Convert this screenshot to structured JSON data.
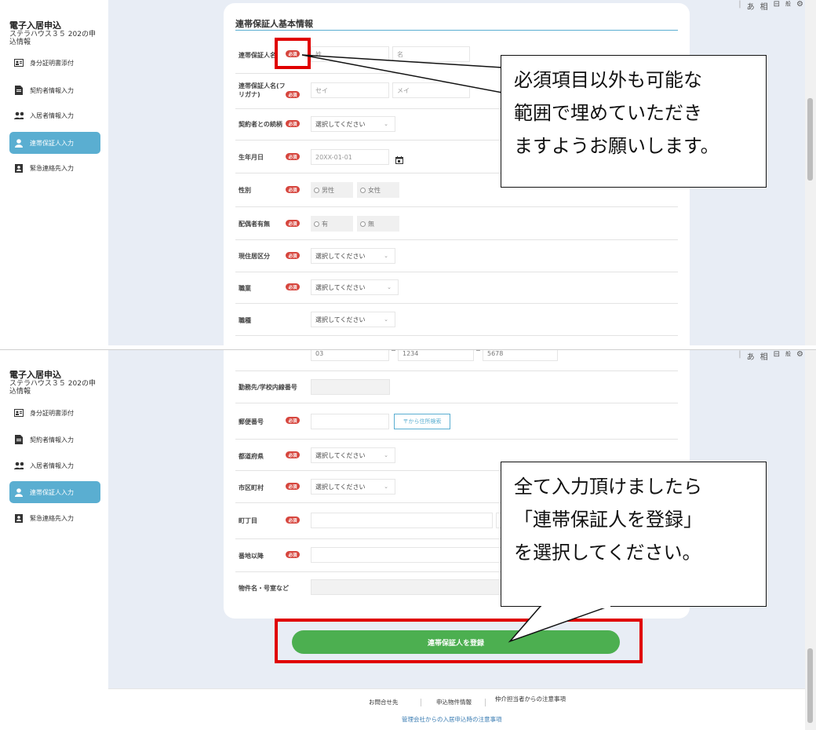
{
  "app": {
    "title": "電子入居申込",
    "subtitle": "ステラハウス３５ 202の申込情報"
  },
  "nav": [
    {
      "label": "身分証明書添付"
    },
    {
      "label": "契約者情報入力"
    },
    {
      "label": "入居者情報入力"
    },
    {
      "label": "連帯保証人入力"
    },
    {
      "label": "緊急連絡先入力"
    }
  ],
  "ime_bar": {
    "kana": "あ",
    "kanji": "相",
    "pad": "⊟",
    "mode": "般",
    "gear": "⚙"
  },
  "form_top": {
    "section_title": "連帯保証人基本情報",
    "required_badge": "必須",
    "rows": {
      "name": {
        "label": "連帯保証人名",
        "last_ph": "姓",
        "first_ph": "名"
      },
      "kana": {
        "label": "連帯保証人名(フリガナ)",
        "last_ph": "セイ",
        "first_ph": "メイ"
      },
      "relation": {
        "label": "契約者との続柄",
        "value": "選択してください"
      },
      "birth": {
        "label": "生年月日",
        "value": "20XX-01-01"
      },
      "gender": {
        "label": "性別",
        "opt1": "男性",
        "opt2": "女性"
      },
      "spouse": {
        "label": "配偶者有無",
        "opt1": "有",
        "opt2": "無"
      },
      "residence": {
        "label": "現住居区分",
        "value": "選択してください"
      },
      "job": {
        "label": "職業",
        "value": "選択してください"
      },
      "job_type": {
        "label": "職種",
        "value": "選択してください"
      }
    }
  },
  "form_bottom": {
    "phone": {
      "p1": "03",
      "p2": "1234",
      "p3": "5678",
      "sep": "−"
    },
    "rows": {
      "extension": {
        "label": "勤務先/学校内線番号"
      },
      "zip": {
        "label": "郵便番号",
        "button": "〒から住所検索"
      },
      "pref": {
        "label": "都道府県",
        "value": "選択してください"
      },
      "city": {
        "label": "市区町村",
        "value": "選択してください"
      },
      "town": {
        "label": "町丁目"
      },
      "street": {
        "label": "番地以降"
      },
      "building": {
        "label": "物件名・号室など"
      }
    },
    "submit_label": "連帯保証人を登録"
  },
  "callouts": {
    "top": "必須項目以外も可能な\n範囲で埋めていただき\nますようお願いします。",
    "bottom": "全て入力頂けましたら\n「連帯保証人を登録」\nを選択してください。"
  },
  "footer": {
    "contact": "お問合せ先",
    "property_info": "申込物件情報",
    "agent_notice": "仲介担当者からの注意事項",
    "management_notice": "管理会社からの入居申込時の注意事項"
  },
  "colors": {
    "accent": "#5aaed1",
    "required_red": "#d6453d",
    "submit_green": "#4caf50",
    "annotation_red": "#e00000",
    "main_bg": "#e8edf5"
  }
}
